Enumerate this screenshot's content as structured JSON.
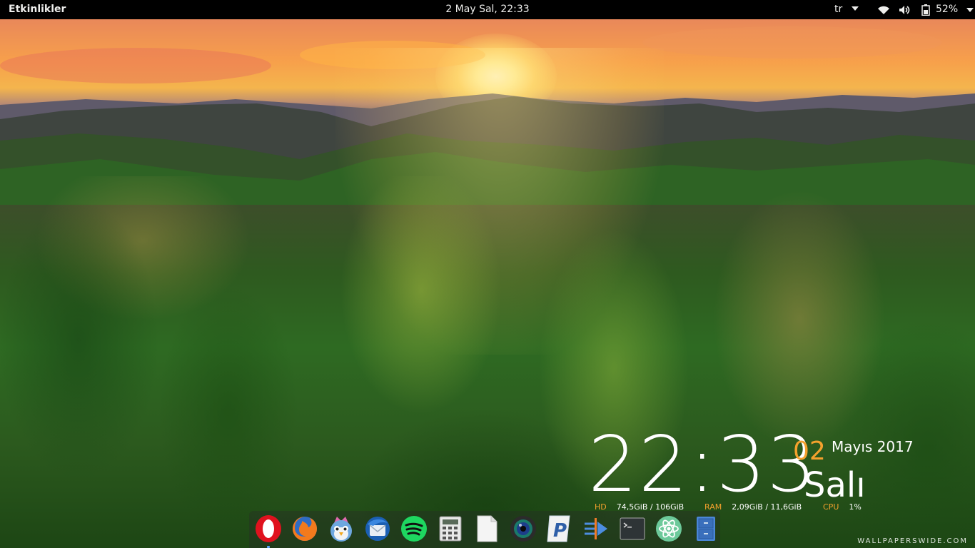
{
  "topbar": {
    "activities": "Etkinlikler",
    "datetime": "2 May Sal, 22:33",
    "language": "tr",
    "battery_percent": "52%"
  },
  "desklet": {
    "time_hours": "22",
    "time_sep": ":",
    "time_minutes": "33",
    "day_number": "02",
    "month_year": "Mayıs 2017",
    "weekday": "Salı",
    "hd_label": "HD",
    "hd_value": "74,5GiB / 106GiB",
    "ram_label": "RAM",
    "ram_value": "2,09GiB / 11,6GiB",
    "cpu_label": "CPU",
    "cpu_value": "1%"
  },
  "dock": {
    "apps": [
      {
        "name": "opera-icon",
        "running": true
      },
      {
        "name": "firefox-icon",
        "running": false
      },
      {
        "name": "corebird-icon",
        "running": false
      },
      {
        "name": "thunderbird-icon",
        "running": false
      },
      {
        "name": "spotify-icon",
        "running": false
      },
      {
        "name": "calculator-icon",
        "running": false
      },
      {
        "name": "text-editor-icon",
        "running": false
      },
      {
        "name": "camera-icon",
        "running": false
      },
      {
        "name": "pycharm-icon",
        "running": false
      },
      {
        "name": "transfer-icon",
        "running": false
      },
      {
        "name": "terminal-icon",
        "running": false
      },
      {
        "name": "atom-icon",
        "running": false
      },
      {
        "name": "file-manager-icon",
        "running": false
      }
    ]
  },
  "wallpaper": {
    "watermark": "WALLPAPERSWIDE.COM"
  },
  "colors": {
    "accent_orange": "#f4a12d",
    "topbar_bg": "#000000",
    "running_indicator": "#5da5ff"
  }
}
